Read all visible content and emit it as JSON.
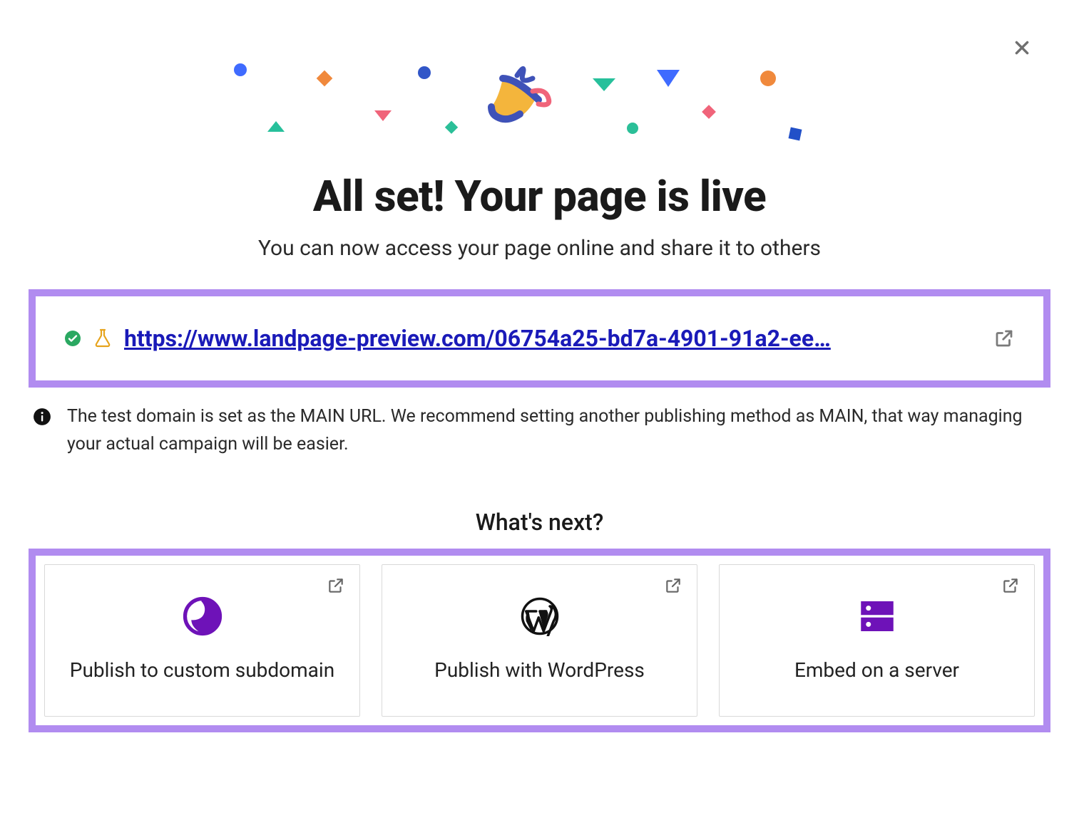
{
  "title": "All set! Your page is live",
  "subtitle": "You can now access your page online and share it to others",
  "url": "https://www.landpage-preview.com/06754a25-bd7a-4901-91a2-ee…",
  "info_note": "The test domain is set as the MAIN URL. We recommend setting another publishing method as MAIN, that way managing your actual campaign will be easier.",
  "next_heading": "What's next?",
  "options": [
    {
      "label": "Publish to custom subdomain"
    },
    {
      "label": "Publish with WordPress"
    },
    {
      "label": "Embed on a server"
    }
  ],
  "icons": {
    "close": "close-icon",
    "check": "check-circle-icon",
    "flask": "flask-icon",
    "open_external": "open-external-icon",
    "info": "info-icon",
    "globe": "globe-icon",
    "wordpress": "wordpress-icon",
    "server": "server-icon"
  },
  "colors": {
    "highlight_border": "#b18cf0",
    "link": "#1a1ab8",
    "option_purple": "#6e12b8"
  }
}
